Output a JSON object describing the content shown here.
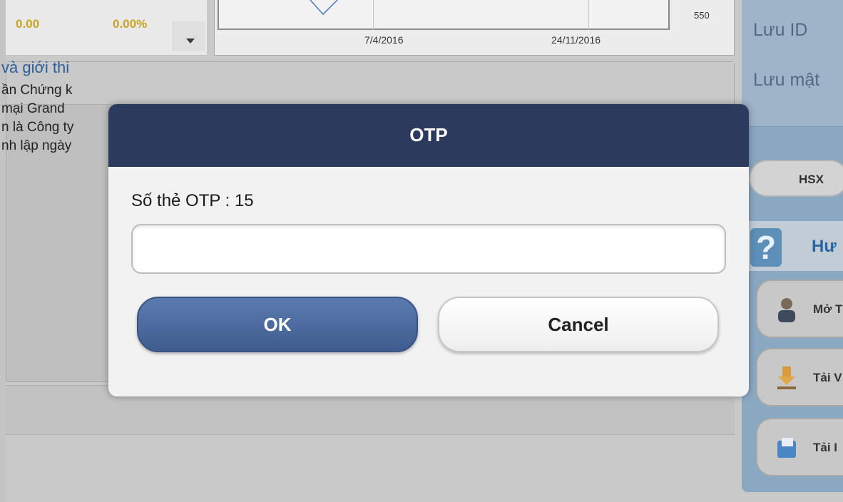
{
  "quote": {
    "change": "0.00",
    "change_pct": "0.00%",
    "accent_color": "#c8a422"
  },
  "mini_chart": {
    "y_label": "550",
    "x_labels": [
      "7/4/2016",
      "24/11/2016"
    ]
  },
  "news": {
    "title": "và giới thi",
    "lines": [
      "ần Chứng k",
      "mại Grand",
      "n là Công ty",
      "nh lập ngày"
    ]
  },
  "right_panel": {
    "login_id_label": "Lưu ID",
    "login_pw_label": "Lưu mật",
    "exchange_tab": "HSX",
    "help_label": "Hư",
    "side_buttons": [
      "Mở T",
      "Tải V",
      "Tải I"
    ]
  },
  "dialog": {
    "title": "OTP",
    "otp_label": "Số thẻ OTP : 15",
    "otp_value": "",
    "ok_label": "OK",
    "cancel_label": "Cancel",
    "header_color": "#2c3a5e"
  }
}
